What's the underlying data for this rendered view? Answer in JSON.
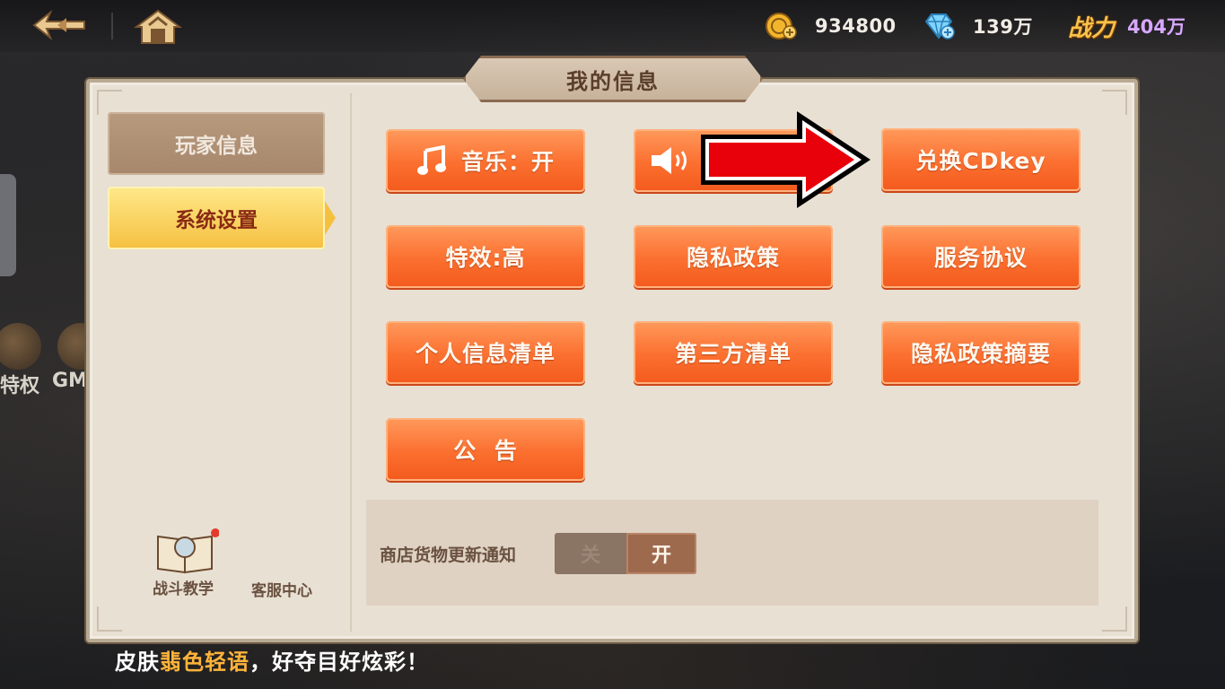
{
  "topbar": {
    "gold_value": "934800",
    "gem_value": "139万",
    "power_label": "战力",
    "power_value": "404万",
    "icons": [
      "back-icon",
      "home-icon",
      "gold-coin-icon",
      "diamond-icon"
    ]
  },
  "left_overlay": {
    "items": [
      {
        "label": "特权"
      },
      {
        "label": "GM"
      }
    ]
  },
  "panel": {
    "title": "我的信息",
    "tabs": [
      {
        "label": "玩家信息",
        "selected": false
      },
      {
        "label": "系统设置",
        "selected": true
      }
    ],
    "buttons": {
      "music": "音乐：开",
      "cdkey": "兑换CDkey",
      "effects": "特效:高",
      "privacy": "隐私政策",
      "service": "服务协议",
      "personal_list": "个人信息清单",
      "third_party": "第三方清单",
      "privacy_summary": "隐私政策摘要",
      "notice": "公  告"
    },
    "notification": {
      "label": "商店货物更新通知",
      "off_label": "关",
      "on_label": "开",
      "value": "开"
    },
    "footer": {
      "tutorial": "战斗教学",
      "support": "客服中心"
    }
  },
  "ticker": {
    "prefix": "皮肤",
    "highlight": "翡色轻语",
    "suffix": "，好夺目好炫彩！"
  },
  "colors": {
    "button_orange": "#fb6f2f",
    "tab_selected": "#f5c040",
    "panel_bg": "#e8e0d3",
    "annotation_arrow": "#e8000a"
  }
}
